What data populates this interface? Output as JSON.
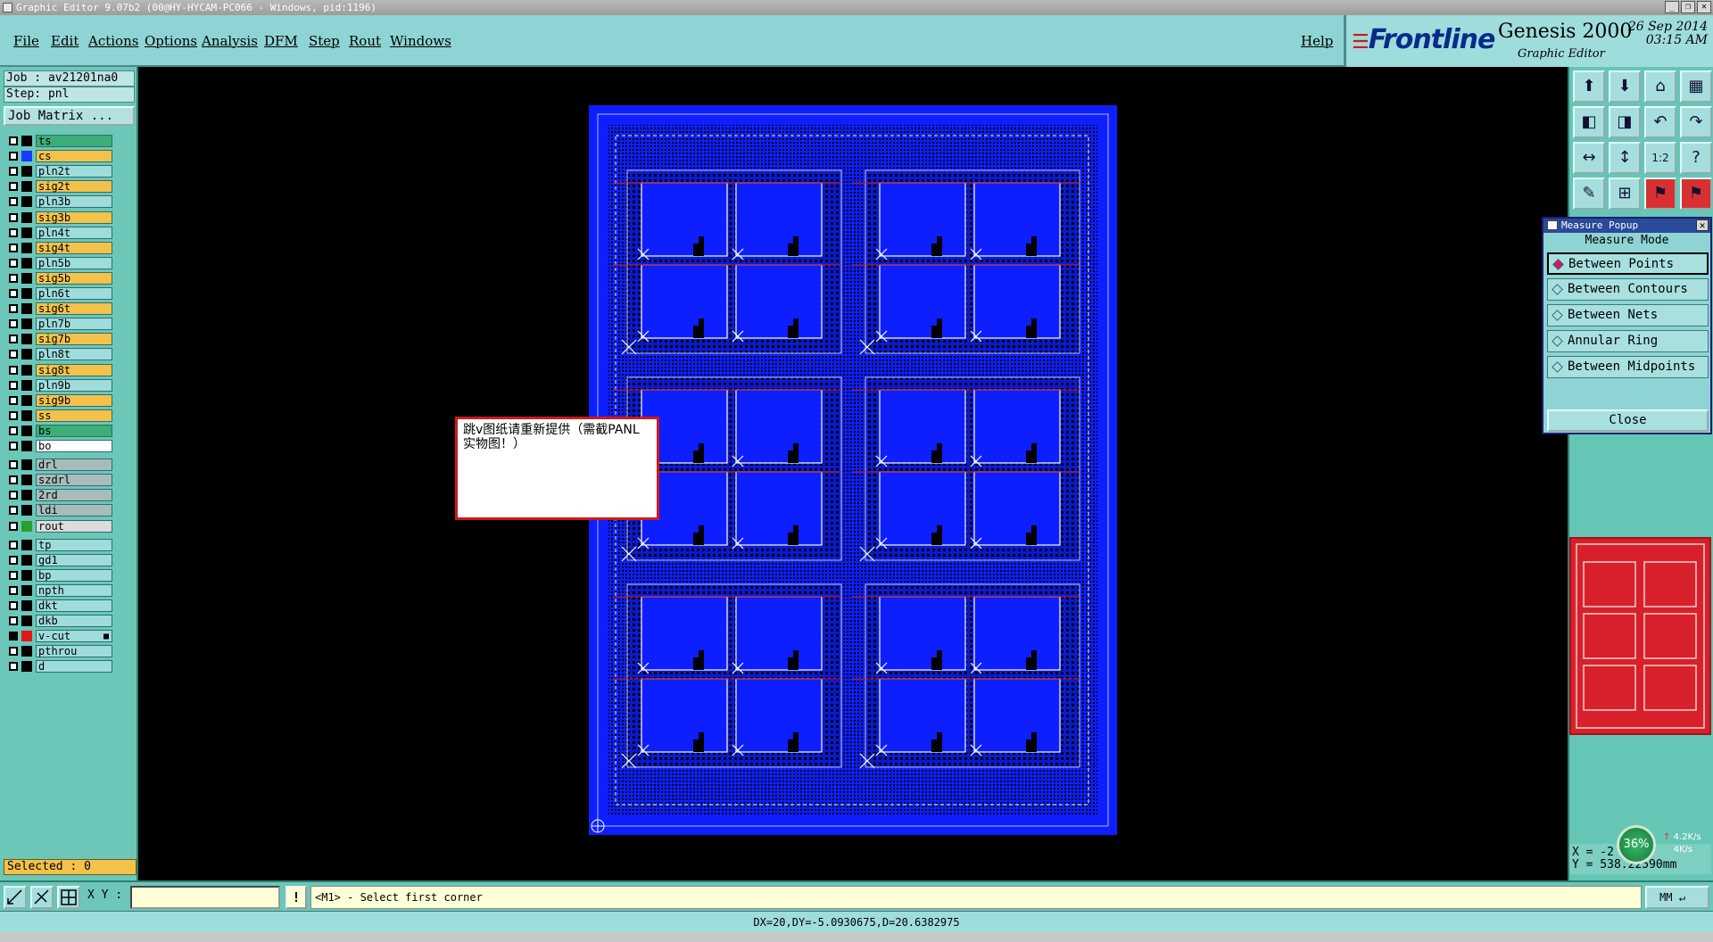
{
  "window": {
    "title": "Graphic Editor 9.07b2 (00@HY-HYCAM-PC066 - Windows, pid:1196)",
    "buttons": [
      "_",
      "❐",
      "✕"
    ]
  },
  "menu": {
    "items": [
      "File",
      "Edit",
      "Actions",
      "Options",
      "Analysis",
      "DFM",
      "Step",
      "Rout",
      "Windows"
    ],
    "help": "Help"
  },
  "brand": {
    "logo": "Frontline",
    "product": "Genesis 2000",
    "subtitle": "Graphic Editor",
    "date": "26 Sep 2014",
    "time": "03:15 AM"
  },
  "job": {
    "job_label": "Job : av21201na0",
    "step_label": "Step: pnl",
    "matrix_button": "Job Matrix ..."
  },
  "layers": [
    {
      "name": "ts",
      "color": "#3cae76",
      "swatch": "#000000",
      "checked": false
    },
    {
      "name": "cs",
      "color": "#f2c24a",
      "swatch": "#1a3aff",
      "checked": false
    },
    {
      "name": "pln2t",
      "color": "#9fdcdc",
      "swatch": "#000000",
      "checked": false
    },
    {
      "name": "sig2t",
      "color": "#f2c24a",
      "swatch": "#000000",
      "checked": false
    },
    {
      "name": "pln3b",
      "color": "#9fdcdc",
      "swatch": "#000000",
      "checked": false
    },
    {
      "name": "sig3b",
      "color": "#f2c24a",
      "swatch": "#000000",
      "checked": false
    },
    {
      "name": "pln4t",
      "color": "#9fdcdc",
      "swatch": "#000000",
      "checked": false
    },
    {
      "name": "sig4t",
      "color": "#f2c24a",
      "swatch": "#000000",
      "checked": false
    },
    {
      "name": "pln5b",
      "color": "#9fdcdc",
      "swatch": "#000000",
      "checked": false
    },
    {
      "name": "sig5b",
      "color": "#f2c24a",
      "swatch": "#000000",
      "checked": false
    },
    {
      "name": "pln6t",
      "color": "#9fdcdc",
      "swatch": "#000000",
      "checked": false
    },
    {
      "name": "sig6t",
      "color": "#f2c24a",
      "swatch": "#000000",
      "checked": false
    },
    {
      "name": "pln7b",
      "color": "#9fdcdc",
      "swatch": "#000000",
      "checked": false
    },
    {
      "name": "sig7b",
      "color": "#f2c24a",
      "swatch": "#000000",
      "checked": false
    },
    {
      "name": "pln8t",
      "color": "#9fdcdc",
      "swatch": "#000000",
      "checked": false
    },
    {
      "name": "sig8t",
      "color": "#f2c24a",
      "swatch": "#000000",
      "checked": false
    },
    {
      "name": "pln9b",
      "color": "#9fdcdc",
      "swatch": "#000000",
      "checked": false
    },
    {
      "name": "sig9b",
      "color": "#f2c24a",
      "swatch": "#000000",
      "checked": false
    },
    {
      "name": "ss",
      "color": "#f2c24a",
      "swatch": "#000000",
      "checked": false
    },
    {
      "name": "bs",
      "color": "#3cae76",
      "swatch": "#000000",
      "checked": false
    },
    {
      "name": "bo",
      "color": "#ffffff",
      "swatch": "#000000",
      "checked": false
    },
    {
      "name": "drl",
      "color": "#a8bcbc",
      "swatch": "#000000",
      "checked": false
    },
    {
      "name": "szdrl",
      "color": "#a8bcbc",
      "swatch": "#000000",
      "checked": false
    },
    {
      "name": "2rd",
      "color": "#a8bcbc",
      "swatch": "#000000",
      "checked": false
    },
    {
      "name": "ldi",
      "color": "#a8bcbc",
      "swatch": "#000000",
      "checked": false
    },
    {
      "name": "rout",
      "color": "#dcdcdc",
      "swatch": "#2aa02a",
      "checked": false
    },
    {
      "name": "tp",
      "color": "#9fdcdc",
      "swatch": "#000000",
      "checked": false
    },
    {
      "name": "gd1",
      "color": "#9fdcdc",
      "swatch": "#000000",
      "checked": false
    },
    {
      "name": "bp",
      "color": "#9fdcdc",
      "swatch": "#000000",
      "checked": false
    },
    {
      "name": "npth",
      "color": "#9fdcdc",
      "swatch": "#000000",
      "checked": false
    },
    {
      "name": "dkt",
      "color": "#9fdcdc",
      "swatch": "#000000",
      "checked": false
    },
    {
      "name": "dkb",
      "color": "#9fdcdc",
      "swatch": "#000000",
      "checked": false
    },
    {
      "name": "v-cut",
      "color": "#9fdcdc",
      "swatch": "#e01818",
      "checked": true,
      "marker": "■"
    },
    {
      "name": "pthrou",
      "color": "#9fdcdc",
      "swatch": "#000000",
      "checked": false
    },
    {
      "name": "d",
      "color": "#9fdcdc",
      "swatch": "#000000",
      "checked": false
    }
  ],
  "selected": "Selected : 0",
  "note": "跳v图纸请重新提供（需截PANL实物图！）",
  "measure": {
    "title": "Measure Popup",
    "mode_label": "Measure Mode",
    "options": [
      "Between Points",
      "Between Contours",
      "Between Nets",
      "Annular Ring",
      "Between Midpoints"
    ],
    "selected_option": "Between Points",
    "close": "Close"
  },
  "toolbar_icons": [
    "zoom-home-icon",
    "save-icon",
    "home-icon",
    "layout-icon",
    "move-left-icon",
    "move-right-icon",
    "undo-icon",
    "redo-icon",
    "fit-width-icon",
    "fit-height-icon",
    "scale-icon",
    "help-icon",
    "snap-icon",
    "grid-icon",
    "measure-icon",
    "analyze-icon"
  ],
  "coords": {
    "x": "X = -2",
    "y": "Y = 538.22590mm"
  },
  "speed": {
    "percent": "36%",
    "up": "4.2K/s",
    "down": "4K/s"
  },
  "cmd": {
    "xy_label": "X Y :",
    "xy_value": "",
    "excl": "!",
    "prompt": "<M1> - Select first corner",
    "units": "MM"
  },
  "status": "DX=20,DY=-5.0930675,D=20.6382975",
  "colors": {
    "panel": "#6cc7b8",
    "menu": "#8fd4d4",
    "board": "#0d1fff",
    "accent": "#d01818"
  }
}
